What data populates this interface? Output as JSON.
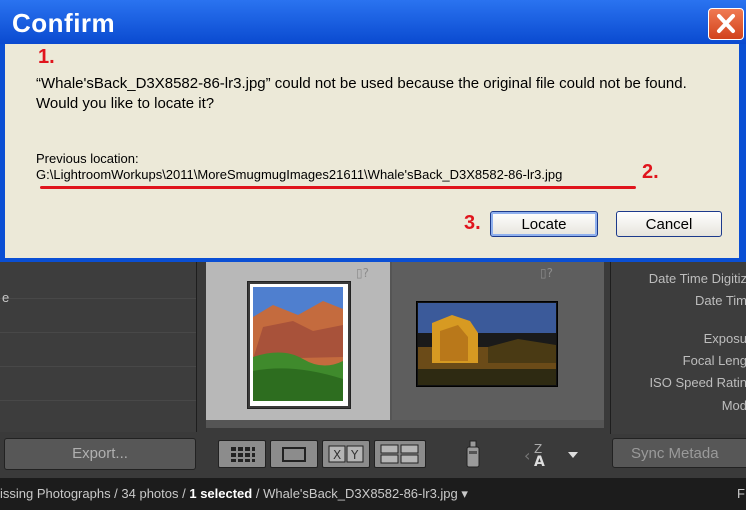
{
  "dialog": {
    "title": "Confirm",
    "message": "“Whale'sBack_D3X8582-86-lr3.jpg” could not be used because the original file could not be found. Would you like to locate it?",
    "previous_label": "Previous location:",
    "previous_path": "G:\\LightroomWorkups\\2011\\MoreSmugmugImages21611\\Whale'sBack_D3X8582-86-lr3.jpg",
    "locate_label": "Locate",
    "cancel_label": "Cancel",
    "annotations": [
      "1.",
      "2.",
      "3."
    ],
    "annotation_color": "#e0141c"
  },
  "lightroom": {
    "left_fragment": "e",
    "grid_badges": [
      "▯?",
      "▯?"
    ],
    "metadata_labels": [
      "Date Time Digitiz",
      "Date Tim",
      "Exposu",
      "Focal Leng",
      "ISO Speed Ratin",
      "Mod"
    ],
    "export_label": "Export...",
    "sync_label": "Sync Metada",
    "status": {
      "prefix": "issing Photographs / 34 photos / ",
      "selected": "1 selected",
      "suffix": " / Whale'sBack_D3X8582-86-lr3.jpg ▾",
      "right": "F"
    },
    "sort_glyph": "A↓Z"
  }
}
